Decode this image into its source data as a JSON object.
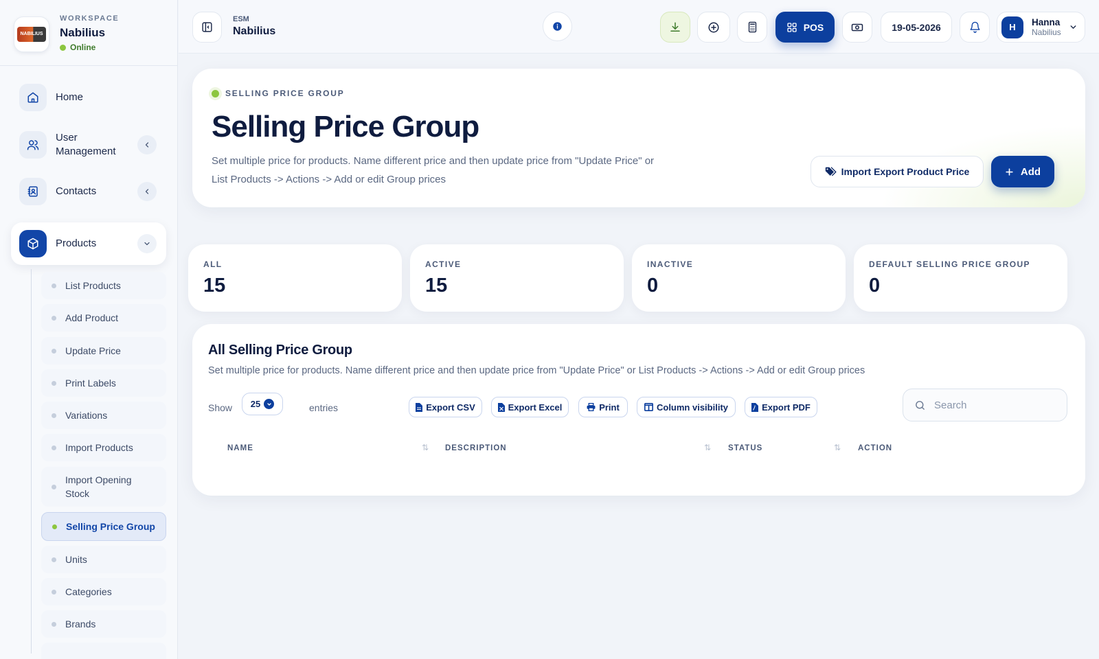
{
  "workspace": {
    "caption": "WORKSPACE",
    "name": "Nabilius",
    "status": "Online",
    "logo_text": "NABILIUS"
  },
  "sidebar": {
    "items": [
      {
        "label": "Home",
        "icon": "home-icon"
      },
      {
        "label": "User Management",
        "icon": "users-icon"
      },
      {
        "label": "Contacts",
        "icon": "contacts-icon"
      },
      {
        "label": "Products",
        "icon": "box-icon"
      }
    ],
    "products_sub": [
      {
        "label": "List Products"
      },
      {
        "label": "Add Product"
      },
      {
        "label": "Update Price"
      },
      {
        "label": "Print Labels"
      },
      {
        "label": "Variations"
      },
      {
        "label": "Import Products"
      },
      {
        "label": "Import Opening Stock"
      },
      {
        "label": "Selling Price Group",
        "active": true
      },
      {
        "label": "Units"
      },
      {
        "label": "Categories"
      },
      {
        "label": "Brands"
      }
    ]
  },
  "topbar": {
    "caption": "ESM",
    "title": "Nabilius",
    "pos_label": "POS",
    "date": "19-05-2026",
    "user_name": "Hanna",
    "user_sub": "Nabilius",
    "user_initial": "H"
  },
  "hero": {
    "kicker": "SELLING PRICE GROUP",
    "title": "Selling Price Group",
    "description": "Set multiple price for products. Name different price and then update price from \"Update Price\" or List Products -> Actions -> Add or edit Group prices",
    "import_label": "Import Export Product Price",
    "add_label": "Add"
  },
  "stats": [
    {
      "label": "ALL",
      "value": "15"
    },
    {
      "label": "ACTIVE",
      "value": "15"
    },
    {
      "label": "INACTIVE",
      "value": "0"
    },
    {
      "label": "DEFAULT SELLING PRICE GROUP",
      "value": "0"
    }
  ],
  "table": {
    "title": "All Selling Price Group",
    "description": "Set multiple price for products. Name different price and then update price from \"Update Price\" or List Products -> Actions -> Add or edit Group prices",
    "show_label": "Show",
    "page_length": "25",
    "entries_label": "entries",
    "buttons": [
      "Export CSV",
      "Export Excel",
      "Print",
      "Column visibility",
      "Export PDF"
    ],
    "search_placeholder": "Search",
    "columns": [
      "NAME",
      "DESCRIPTION",
      "STATUS",
      "ACTION"
    ]
  },
  "colors": {
    "primary": "#0c3f9e",
    "accent_green": "#8cc63f",
    "text": "#0f1c3f"
  }
}
